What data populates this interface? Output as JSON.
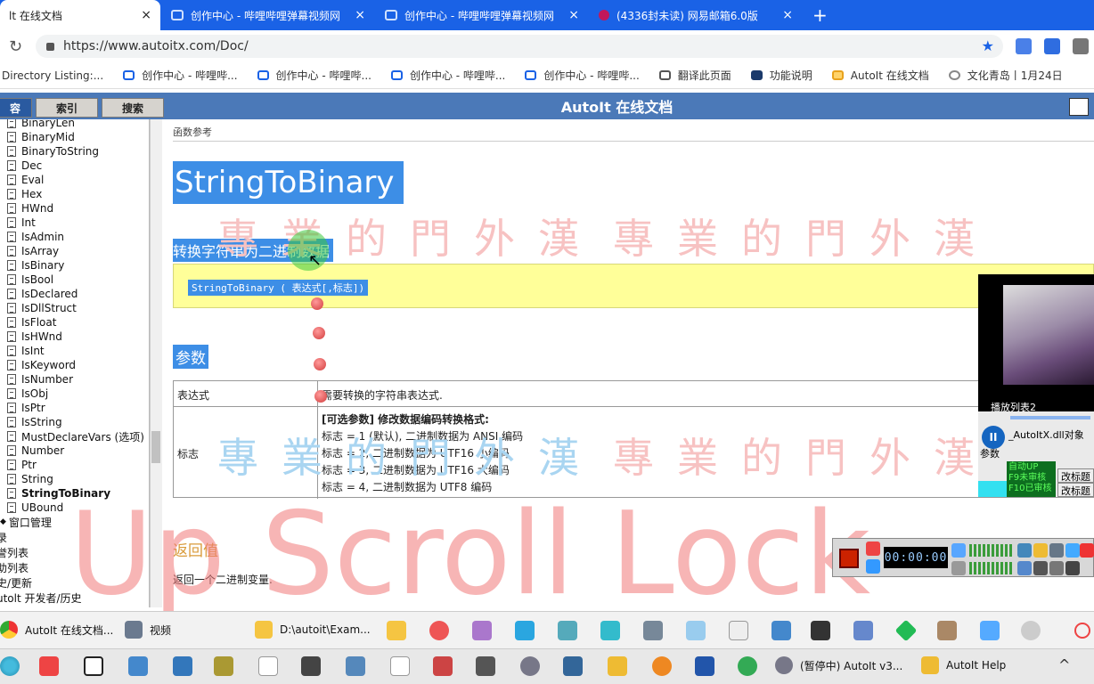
{
  "browser": {
    "tabs": [
      {
        "title": "lt 在线文档",
        "active": true
      },
      {
        "title": "创作中心 - 哔哩哔哩弹幕视频网",
        "active": false
      },
      {
        "title": "创作中心 - 哔哩哔哩弹幕视频网",
        "active": false
      },
      {
        "title": "(4336封未读) 网易邮箱6.0版",
        "active": false
      }
    ],
    "new_tab_label": "+",
    "close_glyph": "×",
    "url": "https://www.autoitx.com/Doc/",
    "bookmarks": [
      "Directory Listing:...",
      "创作中心 - 哔哩哔...",
      "创作中心 - 哔哩哔...",
      "创作中心 - 哔哩哔...",
      "创作中心 - 哔哩哔...",
      "翻译此页面",
      "功能说明",
      "AutoIt 在线文档",
      "文化青岛丨1月24日"
    ]
  },
  "help": {
    "nav_tabs": [
      "容",
      "索引",
      "搜索"
    ],
    "title": "AutoIt 在线文档",
    "tree": [
      "BinaryLen",
      "BinaryMid",
      "BinaryToString",
      "Dec",
      "Eval",
      "Hex",
      "HWnd",
      "Int",
      "IsAdmin",
      "IsArray",
      "IsBinary",
      "IsBool",
      "IsDeclared",
      "IsDllStruct",
      "IsFloat",
      "IsHWnd",
      "IsInt",
      "IsKeyword",
      "IsNumber",
      "IsObj",
      "IsPtr",
      "IsString",
      "MustDeclareVars (选项)",
      "Number",
      "Ptr",
      "String",
      "StringToBinary",
      "UBound"
    ],
    "tree_selected": "StringToBinary",
    "tree_tail": [
      "窗口管理",
      "录",
      "誉列表",
      "助列表",
      "史/更新",
      "utolt 开发者/历史"
    ],
    "breadcrumb": "函数参考",
    "func_title": "StringToBinary",
    "func_desc": "转换字符串为二进制数据",
    "syntax": "StringToBinary ( 表达式[,标志])",
    "params_heading": "参数",
    "params": [
      {
        "name": "表达式",
        "lines": [
          "需要转换的字符串表达式."
        ]
      },
      {
        "name": "标志",
        "lines": [
          "[可选参数] 修改数据编码转换格式:",
          "标志 = 1 (默认), 二进制数据为 ANSI 编码",
          "标志 = 2, 二进制数据为 UTF16 小编码",
          "标志 = 3, 二进制数据为 UTF16 大编码",
          "标志 = 4, 二进制数据为 UTF8 编码"
        ]
      }
    ],
    "return_heading": "返回值",
    "return_text": "返回一个二进制变量."
  },
  "overlays": {
    "scroll_watermark": "Up Scroll Lock",
    "seal_watermark": "專業的門外漢",
    "player": {
      "playlist_label": "播放列表2",
      "file": "_AutoItX.dll对象",
      "param_label": "参数",
      "status": [
        "自动UP",
        "F9未审核",
        "F10已审核"
      ],
      "buttons": [
        "改标题",
        "改标题"
      ],
      "pause_glyph": "II"
    },
    "recorder": {
      "timer": "00:00:00"
    }
  },
  "taskbar": {
    "row1": [
      "AutoIt 在线文档...",
      "视频",
      "D:\\autoit\\Exam..."
    ],
    "row2": [
      "(暂停中) AutoIt v3...",
      "AutoIt Help"
    ],
    "tray_arrow": "^"
  }
}
